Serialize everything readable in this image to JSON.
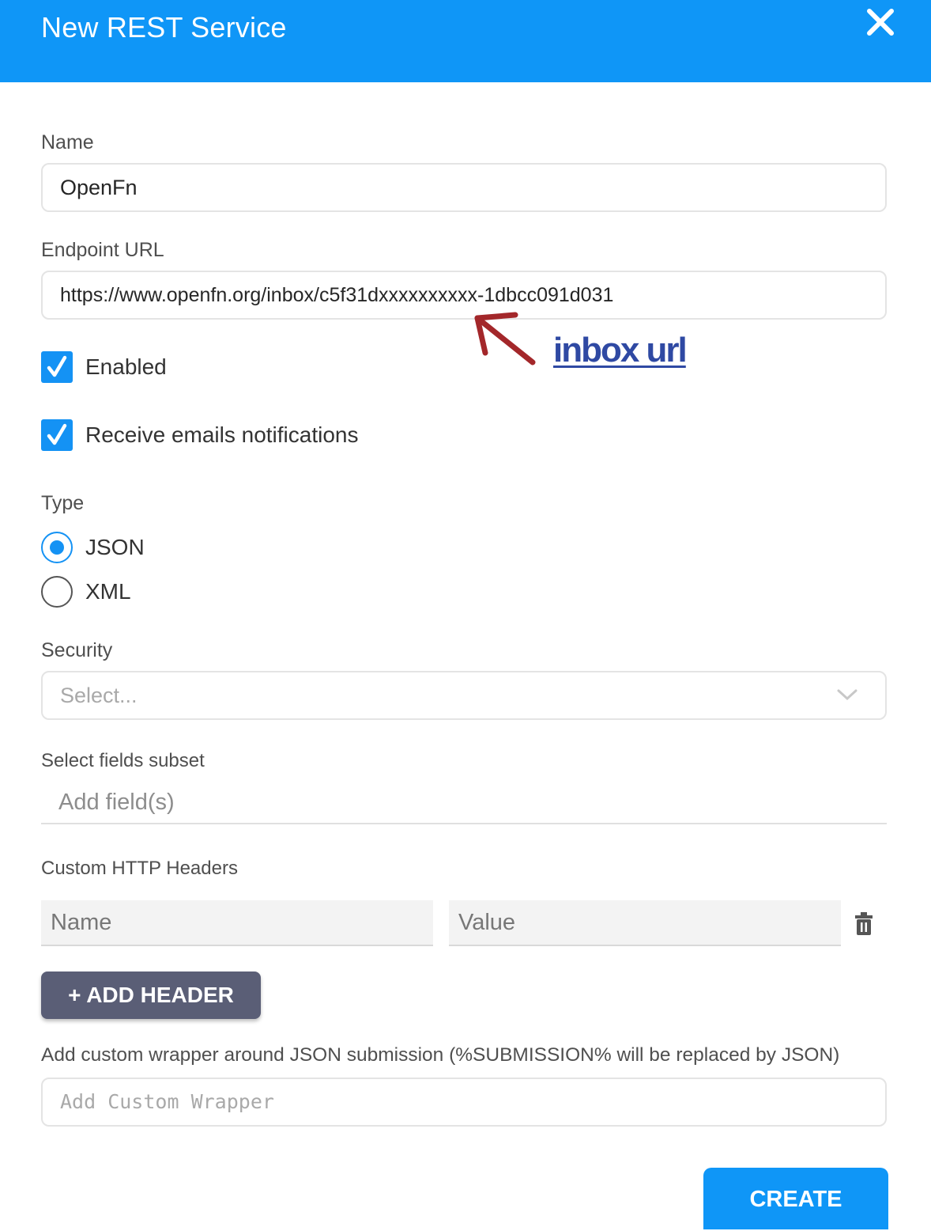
{
  "dialog": {
    "title": "New REST Service",
    "close_icon": "close-icon"
  },
  "form": {
    "name_label": "Name",
    "name_value": "OpenFn",
    "endpoint_label": "Endpoint URL",
    "endpoint_value": "https://www.openfn.org/inbox/c5f31dxxxxxxxxxx-1dbcc091d031",
    "enabled_label": "Enabled",
    "enabled_checked": true,
    "emails_label": "Receive emails notifications",
    "emails_checked": true,
    "type_label": "Type",
    "type_options": [
      "JSON",
      "XML"
    ],
    "type_selected": "JSON",
    "security_label": "Security",
    "security_placeholder": "Select...",
    "fields_label": "Select fields subset",
    "fields_placeholder": "Add field(s)",
    "headers_label": "Custom HTTP Headers",
    "header_name_placeholder": "Name",
    "header_value_placeholder": "Value",
    "add_header_label": "+ ADD HEADER",
    "wrapper_label": "Add custom wrapper around JSON submission (%SUBMISSION% will be replaced by JSON)",
    "wrapper_placeholder": "Add Custom Wrapper",
    "create_label": "CREATE"
  },
  "annotation": {
    "text": "inbox url",
    "color": "#2f49a3",
    "arrow_color": "#a3272a"
  },
  "colors": {
    "header": "#0f96f7",
    "accent": "#1492f4",
    "button_dark": "#5a5e76"
  }
}
